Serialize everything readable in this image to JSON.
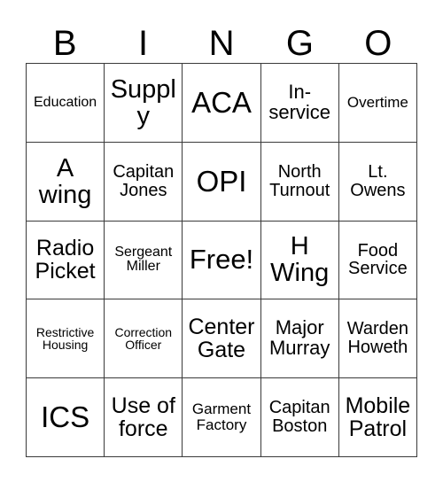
{
  "card": {
    "header_letters": [
      "B",
      "I",
      "N",
      "G",
      "O"
    ],
    "free_space_label": "Free!",
    "rows": [
      [
        {
          "label": "Education",
          "size": "fs-sm"
        },
        {
          "label": "Supply",
          "size": "fs-xl"
        },
        {
          "label": "ACA",
          "size": "fs-huge"
        },
        {
          "label": "In-service",
          "size": "fs-mdl"
        },
        {
          "label": "Overtime",
          "size": "fs-smd"
        }
      ],
      [
        {
          "label": "A wing",
          "size": "fs-xl"
        },
        {
          "label": "Capitan Jones",
          "size": "fs-md"
        },
        {
          "label": "OPI",
          "size": "fs-huge"
        },
        {
          "label": "North Turnout",
          "size": "fs-md"
        },
        {
          "label": "Lt. Owens",
          "size": "fs-md"
        }
      ],
      [
        {
          "label": "Radio Picket",
          "size": "fs-lg"
        },
        {
          "label": "Sergeant Miller",
          "size": "fs-sm"
        },
        {
          "label": "Free!",
          "size": "fs-xxl"
        },
        {
          "label": "H Wing",
          "size": "fs-xl"
        },
        {
          "label": "Food Service",
          "size": "fs-md"
        }
      ],
      [
        {
          "label": "Restrictive Housing",
          "size": "fs-xs"
        },
        {
          "label": "Correction Officer",
          "size": "fs-xs"
        },
        {
          "label": "Center Gate",
          "size": "fs-lg"
        },
        {
          "label": "Major Murray",
          "size": "fs-mdl"
        },
        {
          "label": "Warden Howeth",
          "size": "fs-md"
        }
      ],
      [
        {
          "label": "ICS",
          "size": "fs-huge"
        },
        {
          "label": "Use of force",
          "size": "fs-lg"
        },
        {
          "label": "Garment Factory",
          "size": "fs-smd"
        },
        {
          "label": "Capitan Boston",
          "size": "fs-md"
        },
        {
          "label": "Mobile Patrol",
          "size": "fs-lg"
        }
      ]
    ]
  },
  "colors": {
    "background": "#ffffff",
    "border": "#3a3a3a",
    "text": "#000000"
  }
}
